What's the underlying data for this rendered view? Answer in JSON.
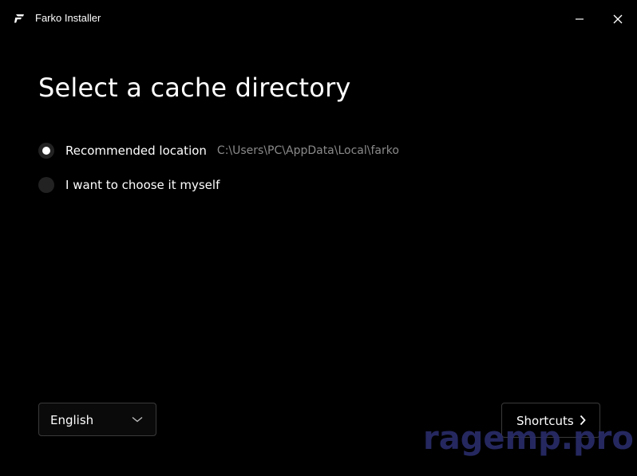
{
  "window": {
    "title": "Farko Installer",
    "logo_icon": "farko-logo-icon",
    "minimize_icon": "minimize-icon",
    "close_icon": "close-icon"
  },
  "page": {
    "title": "Select a cache directory"
  },
  "options": [
    {
      "label": "Recommended location",
      "path": "C:\\Users\\PC\\AppData\\Local\\farko",
      "selected": true
    },
    {
      "label": "I want to choose it myself",
      "selected": false
    }
  ],
  "language": {
    "value": "English",
    "icon": "chevron-down-icon"
  },
  "next_button": {
    "label": "Shortcuts",
    "icon": "chevron-right-icon"
  },
  "watermark": {
    "text": "ragemp.pro",
    "color": "#2a2d6a"
  },
  "colors": {
    "background": "#000000",
    "text": "#ffffff",
    "muted_text": "#8a8a8a",
    "border": "#3a3a3a",
    "radio_bg": "#222222"
  }
}
